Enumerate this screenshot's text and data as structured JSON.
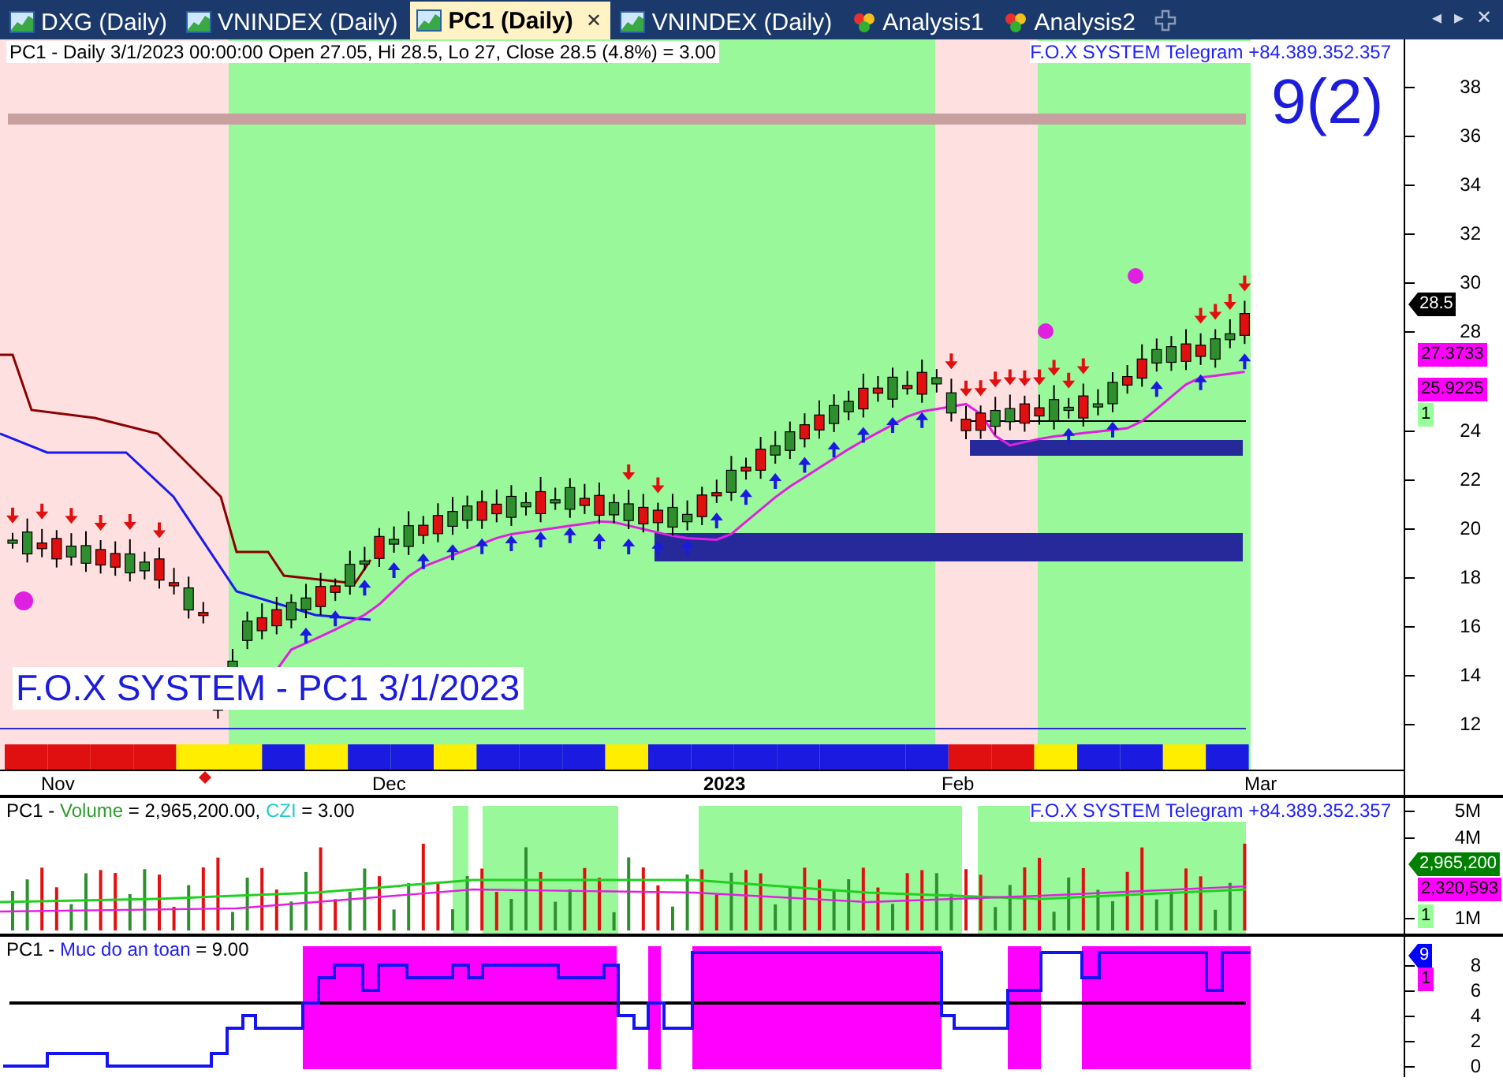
{
  "tabs": [
    {
      "label": "DXG (Daily)",
      "kind": "chart",
      "selected": false
    },
    {
      "label": "VNINDEX (Daily)",
      "kind": "chart",
      "selected": false
    },
    {
      "label": "PC1 (Daily)",
      "kind": "chart",
      "selected": true,
      "close": "✕"
    },
    {
      "label": "VNINDEX (Daily)",
      "kind": "chart",
      "selected": false
    },
    {
      "label": "Analysis1",
      "kind": "analysis",
      "selected": false
    },
    {
      "label": "Analysis2",
      "kind": "analysis",
      "selected": false
    }
  ],
  "tab_controls": [
    "◂",
    "▸",
    "✕"
  ],
  "price_pane": {
    "header": "PC1 - Daily 3/1/2023 00:00:00 Open 27.05, Hi 28.5, Lo 27, Close 28.5 (4.8%)  = 3.00",
    "telegram": "F.O.X SYSTEM Telegram +84.389.352.357",
    "signal": "9(2)",
    "caption": "F.O.X SYSTEM - PC1 3/1/2023",
    "y_ticks": [
      "38",
      "36",
      "34",
      "32",
      "30",
      "28",
      "24",
      "22",
      "20",
      "18",
      "16",
      "14",
      "12"
    ],
    "badges": [
      {
        "text": "28.5",
        "kind": "pointer",
        "color": "#000000"
      },
      {
        "text": "27.3733",
        "kind": "tag",
        "color": "#ff00ff"
      },
      {
        "text": "25.9225",
        "kind": "tag",
        "color": "#ff00ff"
      },
      {
        "text": "1",
        "kind": "tag",
        "color": "#99ff99"
      }
    ]
  },
  "date_axis": [
    {
      "label": "Nov",
      "kind": "month"
    },
    {
      "label": "Dec",
      "kind": "month"
    },
    {
      "label": "2023",
      "kind": "year"
    },
    {
      "label": "Feb",
      "kind": "month"
    },
    {
      "label": "Mar",
      "kind": "month"
    }
  ],
  "volume_pane": {
    "title": [
      {
        "text": "PC1 - ",
        "kind": "plain"
      },
      {
        "text": "Volume",
        "kind": "volume"
      },
      {
        "text": " = 2,965,200.00, ",
        "kind": "plain"
      },
      {
        "text": "CZI",
        "kind": "czi"
      },
      {
        "text": " = 3.00",
        "kind": "plain"
      }
    ],
    "telegram": "F.O.X SYSTEM Telegram +84.389.352.357",
    "y_ticks": [
      "5M",
      "4M",
      "1M"
    ],
    "badges": [
      {
        "text": "2,965,200",
        "kind": "pointer",
        "color": "#008000"
      },
      {
        "text": "2,320,593",
        "kind": "tag",
        "color": "#ff00ff"
      },
      {
        "text": "1",
        "kind": "tag",
        "color": "#99ff99"
      }
    ]
  },
  "safety_pane": {
    "title": [
      {
        "text": "PC1 - ",
        "kind": "plain"
      },
      {
        "text": "Muc do an toan",
        "kind": "safety"
      },
      {
        "text": " = 9.00",
        "kind": "plain"
      }
    ],
    "y_ticks": [
      "8",
      "6",
      "4",
      "2",
      "0"
    ],
    "badges": [
      {
        "text": "9",
        "kind": "pointer",
        "color": "#0000ff"
      },
      {
        "text": "1",
        "kind": "tag",
        "color": "#ff00ff"
      }
    ]
  }
}
